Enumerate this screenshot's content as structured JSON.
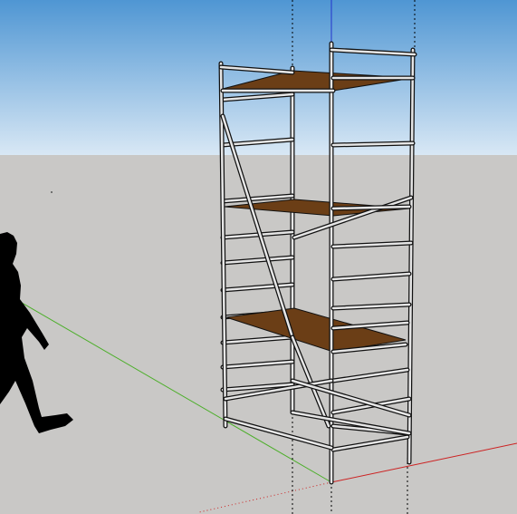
{
  "viewport": {
    "sky_color_top": "#4f96d3",
    "sky_color_horizon": "#d9e8f5",
    "ground_color": "#c9c8c6",
    "axis_colors": {
      "red": "#cc2222",
      "green": "#4caf2a",
      "blue": "#2233cc"
    }
  },
  "model": {
    "object": "scaffold-tower",
    "platform_count": 3,
    "frame_color": "#e6e6e6",
    "platform_color": "#6b3e16"
  },
  "scale_figure": {
    "color": "#000000"
  }
}
